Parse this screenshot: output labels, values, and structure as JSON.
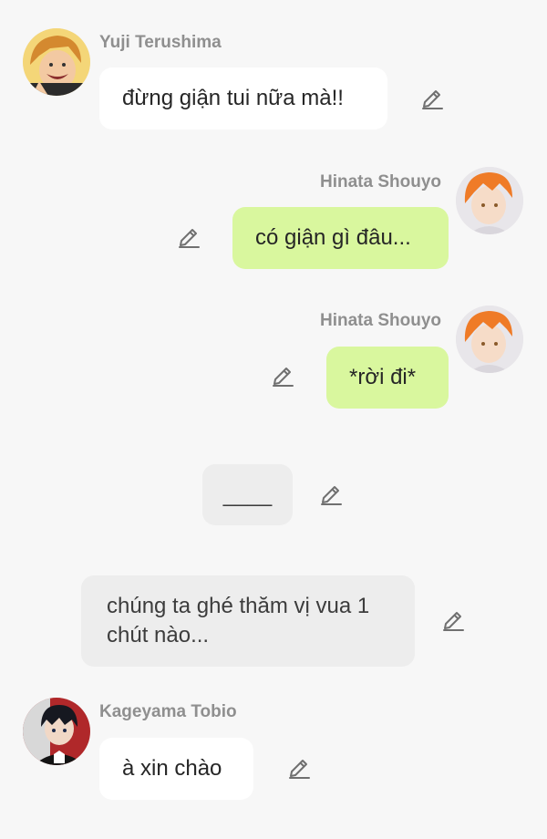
{
  "messages": [
    {
      "sender": "Yuji Terushima",
      "text": "đừng giận tui nữa mà!!"
    },
    {
      "sender": "Hinata Shouyo",
      "text": "có giận gì đâu..."
    },
    {
      "sender": "Hinata Shouyo",
      "text": "*rời đi*"
    },
    {
      "text": "____"
    },
    {
      "text": "chúng ta ghé thăm vị vua 1 chút nào..."
    },
    {
      "sender": "Kageyama Tobio",
      "text": "à xin chào"
    }
  ],
  "icons": {
    "edit": "pencil-edit-icon"
  },
  "colors": {
    "background": "#f7f7f7",
    "bubble_incoming": "#ffffff",
    "bubble_outgoing": "#d9f79e",
    "bubble_narration": "#ededed",
    "name_text": "#8f8f8f"
  }
}
